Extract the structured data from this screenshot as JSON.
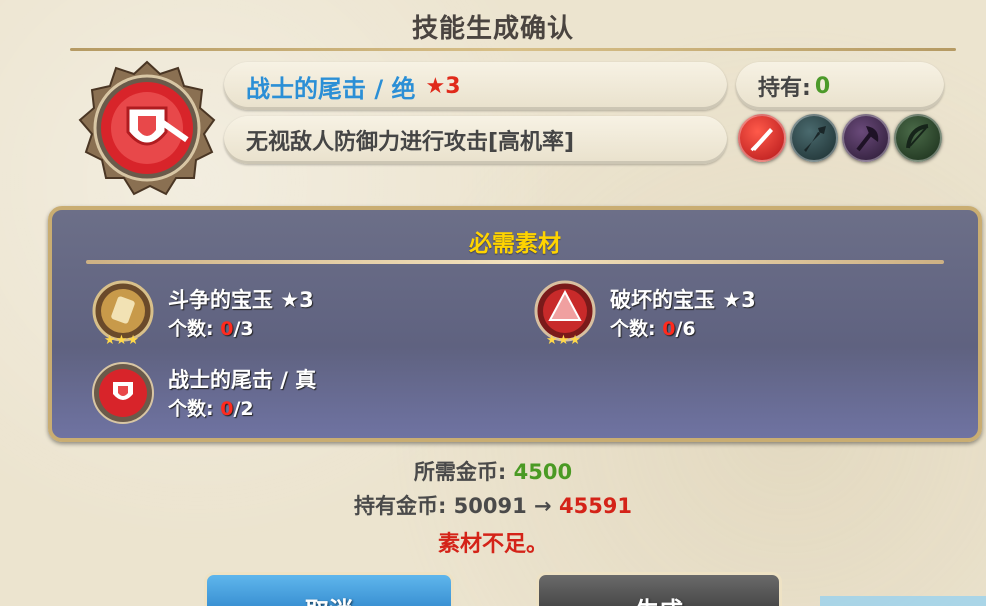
{
  "dialog": {
    "title": "技能生成确认"
  },
  "skill": {
    "name": "战士的尾击 / 绝",
    "star": "★3",
    "description": "无视敌人防御力进行攻击[高机率]",
    "owned_label": "持有:",
    "owned_value": "0",
    "icon": "shield-sword-medallion-icon",
    "weapon_types": [
      {
        "name": "sword-icon",
        "color": "#c8201a",
        "active": true
      },
      {
        "name": "spear-icon",
        "color": "#2f4a4e",
        "active": false
      },
      {
        "name": "axe-icon",
        "color": "#4a2f58",
        "active": false
      },
      {
        "name": "bow-icon",
        "color": "#2e4a2c",
        "active": false
      }
    ]
  },
  "materials": {
    "title": "必需素材",
    "items": [
      {
        "name": "斗争的宝玉 ★3",
        "count_label": "个数:",
        "have": "0",
        "need": "/3",
        "icon": "gold-gem-icon"
      },
      {
        "name": "破坏的宝玉 ★3",
        "count_label": "个数:",
        "have": "0",
        "need": "/6",
        "icon": "red-gem-icon"
      },
      {
        "name": "战士的尾击 / 真",
        "count_label": "个数:",
        "have": "0",
        "need": "/2",
        "icon": "skill-medallion-icon"
      }
    ]
  },
  "gold": {
    "required_label": "所需金币:",
    "required_value": "4500",
    "owned_label": "持有金币:",
    "owned_value": "50091",
    "arrow": "→",
    "after_value": "45591",
    "warning": "素材不足。"
  },
  "buttons": {
    "cancel_label": "取消",
    "create_label": "生成"
  },
  "colors": {
    "accent_blue": "#2b8fd6",
    "warn_red": "#d42318",
    "gold_green": "#4a9a24",
    "panel_title_yellow": "#ffd400"
  }
}
